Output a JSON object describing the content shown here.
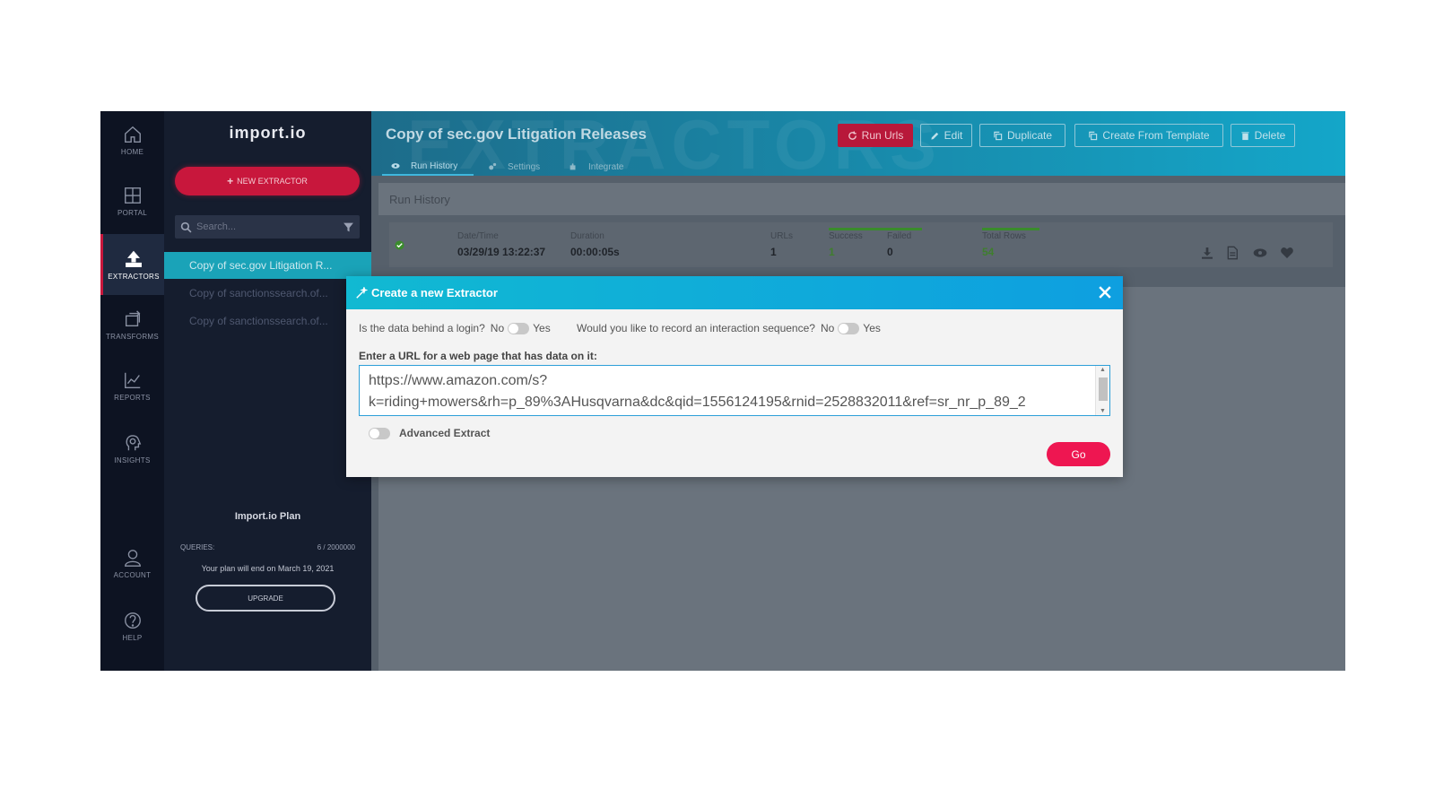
{
  "app": {
    "logo": "import.io"
  },
  "rail": [
    {
      "label": "HOME",
      "icon": "home-icon"
    },
    {
      "label": "PORTAL",
      "icon": "grid-icon"
    },
    {
      "label": "EXTRACTORS",
      "icon": "upload-icon"
    },
    {
      "label": "TRANSFORMS",
      "icon": "transform-icon"
    },
    {
      "label": "REPORTS",
      "icon": "chart-icon"
    },
    {
      "label": "INSIGHTS",
      "icon": "head-icon"
    },
    {
      "label": "ACCOUNT",
      "icon": "user-icon"
    },
    {
      "label": "HELP",
      "icon": "help-icon"
    }
  ],
  "sidebar": {
    "new_extractor": "NEW EXTRACTOR",
    "search_placeholder": "Search...",
    "items": [
      "Copy of sec.gov Litigation R...",
      "Copy of sanctionssearch.of...",
      "Copy of sanctionssearch.of..."
    ],
    "plan": {
      "title": "Import.io Plan",
      "queries_label": "QUERIES:",
      "queries_value": "6 / 2000000",
      "end_text": "Your plan will end on March 19, 2021",
      "upgrade": "UPGRADE"
    }
  },
  "header": {
    "watermark": "EXTRACTORS",
    "title": "Copy of sec.gov Litigation Releases",
    "buttons": {
      "run_urls": "Run Urls",
      "edit": "Edit",
      "duplicate": "Duplicate",
      "create_template": "Create From Template",
      "delete": "Delete"
    },
    "tabs": {
      "run_history": "Run History",
      "settings": "Settings",
      "integrate": "Integrate"
    }
  },
  "run_history": {
    "title": "Run History",
    "row": {
      "datetime_label": "Date/Time",
      "datetime_value": "03/29/19 13:22:37",
      "duration_label": "Duration",
      "duration_value": "00:00:05s",
      "urls_label": "URLs",
      "urls_value": "1",
      "success_label": "Success",
      "success_value": "1",
      "failed_label": "Failed",
      "failed_value": "0",
      "rows_label": "Total Rows",
      "rows_value": "54"
    }
  },
  "modal": {
    "title": "Create a new Extractor",
    "login_q": "Is the data behind a login?",
    "record_q": "Would you like to record an interaction sequence?",
    "no": "No",
    "yes": "Yes",
    "url_label": "Enter a URL for a web page that has data on it:",
    "url_value": "https://www.amazon.com/s?\nk=riding+mowers&rh=p_89%3AHusqvarna&dc&qid=1556124195&rnid=2528832011&ref=sr_nr_p_89_2",
    "advanced": "Advanced Extract",
    "go": "Go"
  },
  "colors": {
    "accent": "#c8173c",
    "header": "#14a6c9",
    "go": "#ee1651",
    "success": "#3a8c2c"
  }
}
